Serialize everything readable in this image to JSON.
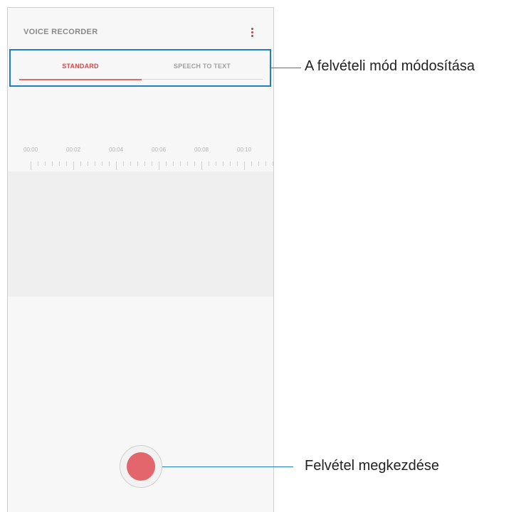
{
  "app": {
    "title": "VOICE RECORDER",
    "more_icon": "more-vertical-icon"
  },
  "tabs": [
    {
      "label": "STANDARD",
      "active": true
    },
    {
      "label": "SPEECH TO TEXT",
      "active": false
    }
  ],
  "timeline": {
    "labels": [
      "00:00",
      "00:02",
      "00:04",
      "00:06",
      "00:08",
      "00:10"
    ]
  },
  "record_button": {
    "icon": "record-icon",
    "color": "#e2666b"
  },
  "annotations": {
    "recording_mode": "A felvételi mód módosítása",
    "start_recording": "Felvétel megkezdése",
    "color": "#1f7fc2"
  }
}
